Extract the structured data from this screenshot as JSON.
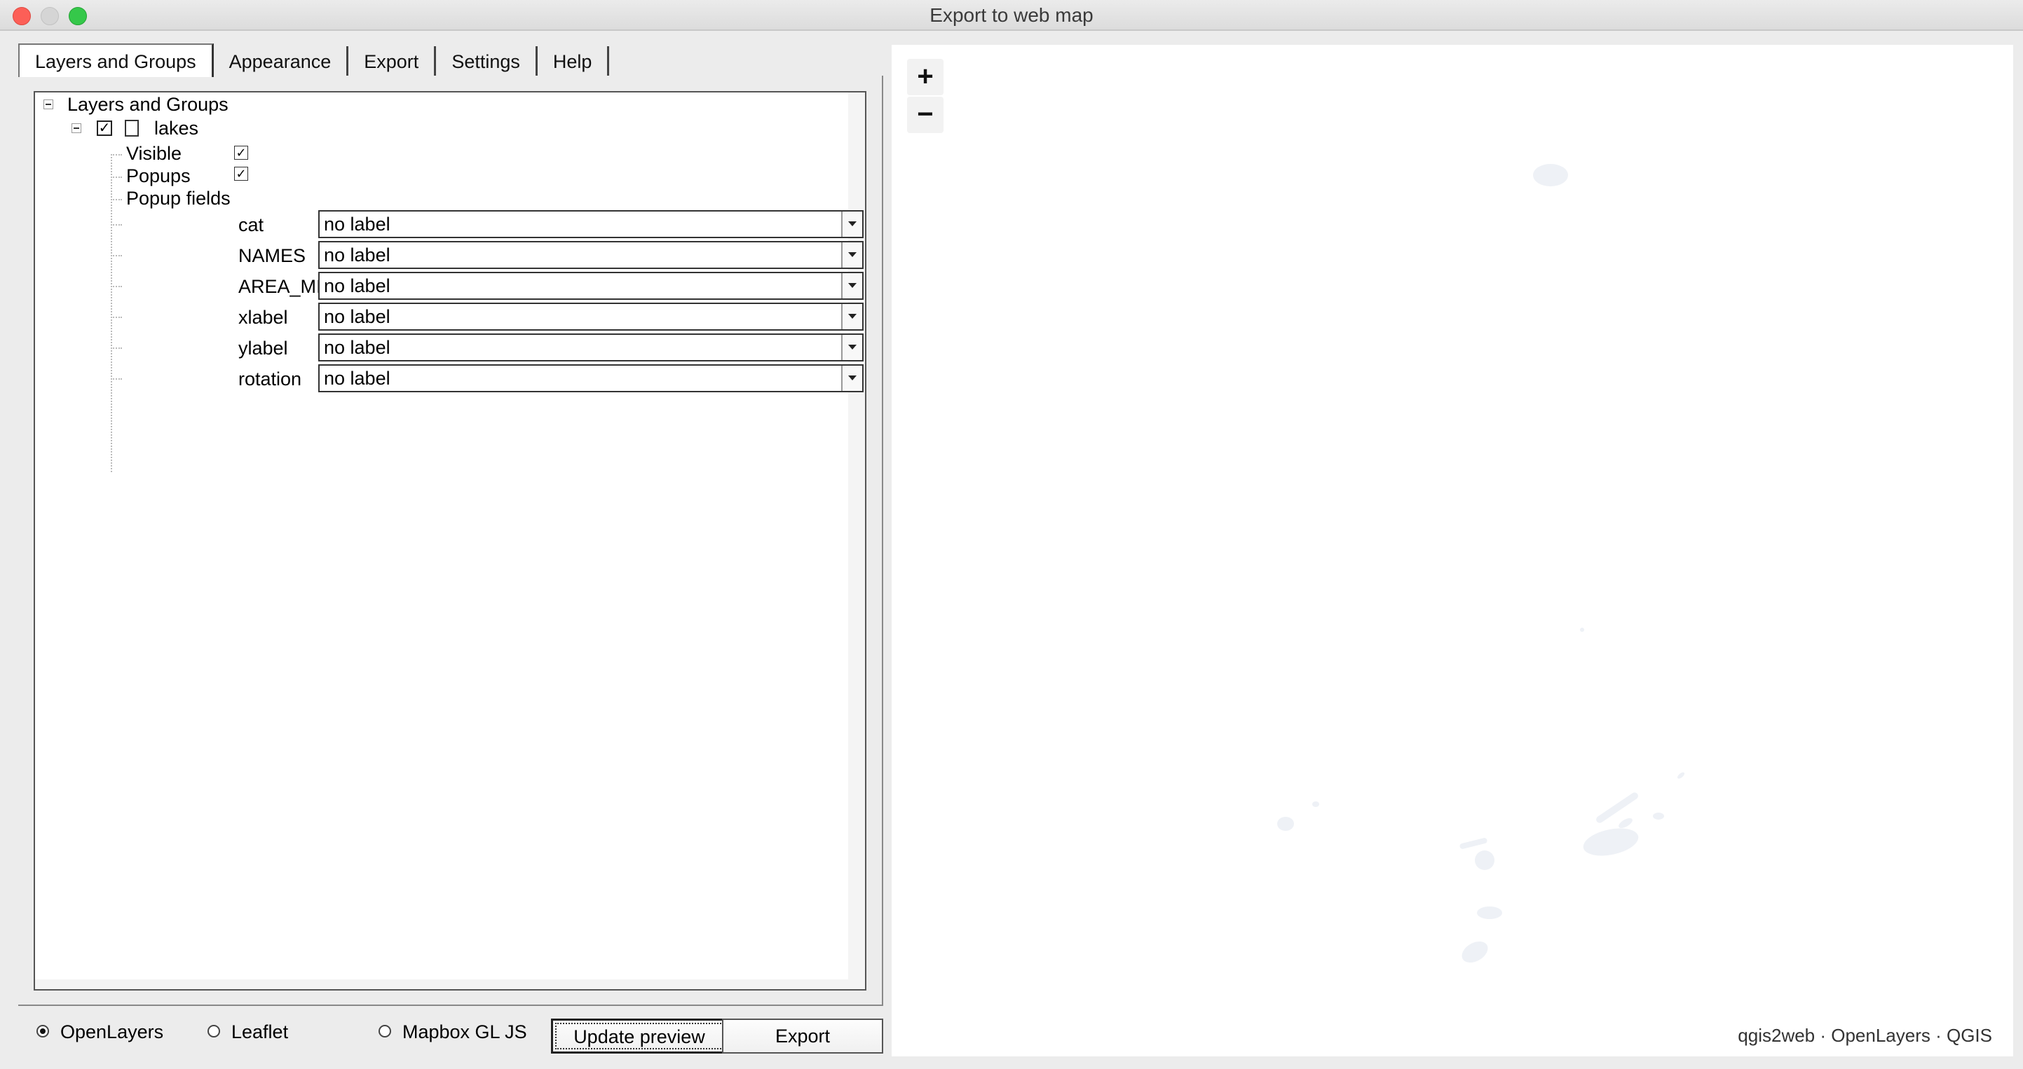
{
  "window": {
    "title": "Export to web map"
  },
  "tabs": [
    {
      "label": "Layers and Groups",
      "active": true
    },
    {
      "label": "Appearance"
    },
    {
      "label": "Export"
    },
    {
      "label": "Settings"
    },
    {
      "label": "Help"
    }
  ],
  "tree": {
    "root_label": "Layers and Groups",
    "layer": {
      "name": "lakes",
      "checked": true,
      "props": [
        {
          "label": "Visible",
          "checked": true
        },
        {
          "label": "Popups",
          "checked": true
        }
      ],
      "popup_fields_label": "Popup fields",
      "fields": [
        {
          "name": "cat",
          "value": "no label"
        },
        {
          "name": "NAMES",
          "value": "no label"
        },
        {
          "name": "AREA_MI",
          "value": "no label"
        },
        {
          "name": "xlabel",
          "value": "no label"
        },
        {
          "name": "ylabel",
          "value": "no label"
        },
        {
          "name": "rotation",
          "value": "no label"
        }
      ]
    }
  },
  "bottom": {
    "options": [
      {
        "label": "OpenLayers",
        "selected": true
      },
      {
        "label": "Leaflet",
        "selected": false
      },
      {
        "label": "Mapbox GL JS",
        "selected": false
      }
    ],
    "update_preview_label": "Update preview",
    "export_label": "Export"
  },
  "map": {
    "zoom_in": "+",
    "zoom_out": "−",
    "attribution": "qgis2web · OpenLayers · QGIS"
  },
  "colors": {
    "close": "#fc5f57",
    "minimize": "#d5d5d5",
    "maximize": "#35c84a",
    "lake_fill": "#eef1f6"
  }
}
